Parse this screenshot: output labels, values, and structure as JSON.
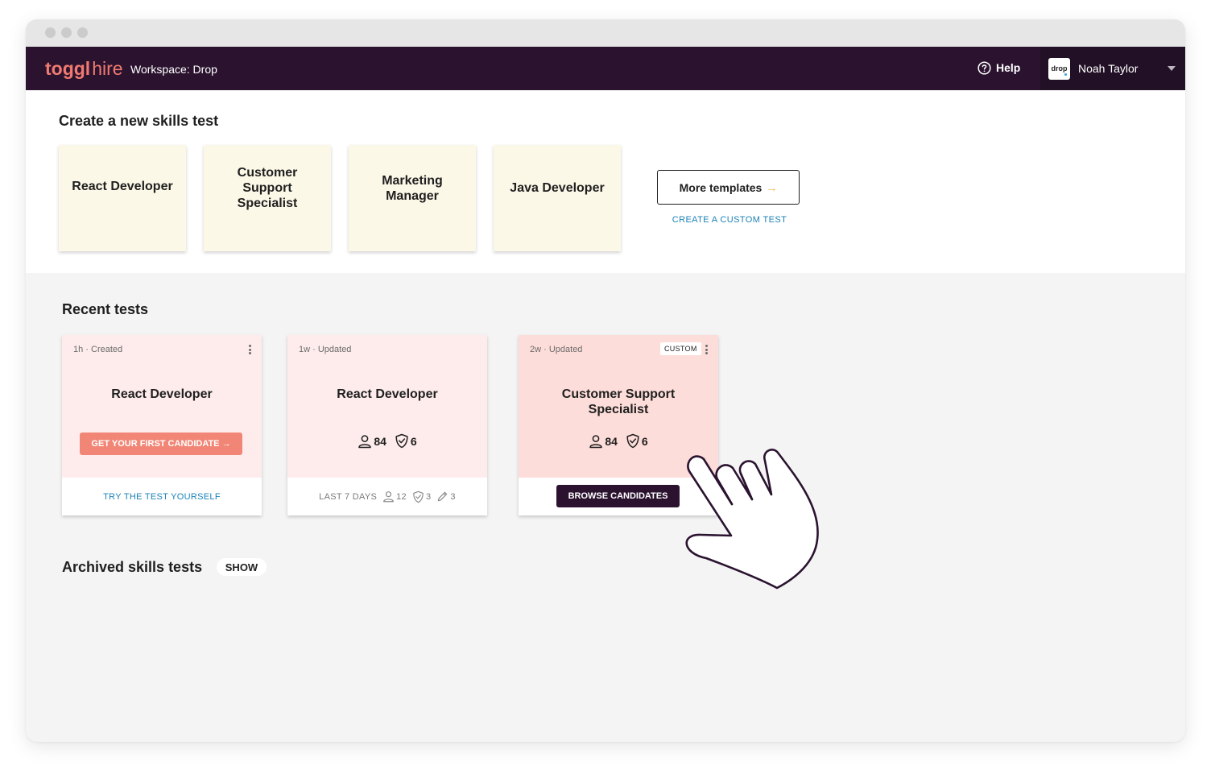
{
  "nav": {
    "logo_bold": "toggl",
    "logo_light": "hire",
    "workspace": "Workspace: Drop",
    "help": "Help",
    "avatar_text": "drop",
    "user_name": "Noah Taylor"
  },
  "create": {
    "title": "Create a new skills test",
    "templates": [
      "React Developer",
      "Customer Support Specialist",
      "Marketing Manager",
      "Java Developer"
    ],
    "more_templates": "More templates",
    "more_arrow": "→",
    "custom_link": "CREATE A CUSTOM TEST"
  },
  "recent": {
    "title": "Recent tests",
    "cards": [
      {
        "meta": "1h · Created",
        "title": "React Developer",
        "cta": "GET YOUR FIRST CANDIDATE →",
        "footer_link": "TRY THE TEST YOURSELF",
        "bg": "#fdeceb"
      },
      {
        "meta": "1w · Updated",
        "title": "React Developer",
        "candidates": "84",
        "passed": "6",
        "footer_label": "LAST 7 DAYS",
        "footer_candidates": "12",
        "footer_passed": "3",
        "footer_reviewed": "3",
        "bg": "#fdeceb"
      },
      {
        "meta": "2w · Updated",
        "badge": "CUSTOM",
        "title": "Customer Support Specialist",
        "candidates": "84",
        "passed": "6",
        "cta": "BROWSE CANDIDATES",
        "bg": "#fdddd9"
      }
    ]
  },
  "archived": {
    "title": "Archived skills tests",
    "show": "SHOW"
  },
  "icons": {
    "help": "question-circle-icon",
    "caret": "caret-down-icon",
    "kebab": "kebab-menu-icon",
    "candidates": "person-icon",
    "passed": "shield-check-icon",
    "reviewed": "pencil-icon",
    "pointer": "hand-pointer-icon"
  },
  "colors": {
    "nav_bg": "#2b1330",
    "brand_coral": "#f07a6f",
    "cta_coral": "#f28676",
    "link_blue": "#1b82b8",
    "template_bg": "#fcf8e8",
    "accent_arrow": "#f5b24a"
  }
}
